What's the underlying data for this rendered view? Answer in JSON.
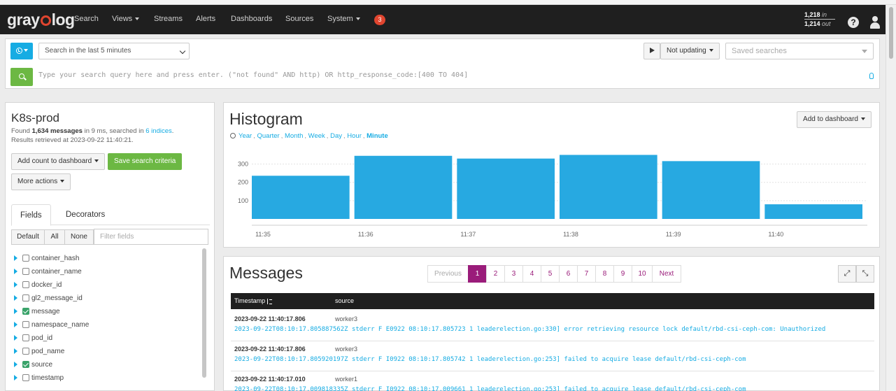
{
  "navbar": {
    "logo": "graylog",
    "items": [
      {
        "label": "Search",
        "dropdown": false
      },
      {
        "label": "Views",
        "dropdown": true
      },
      {
        "label": "Streams",
        "dropdown": false
      },
      {
        "label": "Alerts",
        "dropdown": false
      },
      {
        "label": "Dashboards",
        "dropdown": false
      },
      {
        "label": "Sources",
        "dropdown": false
      },
      {
        "label": "System",
        "dropdown": true
      }
    ],
    "notification_count": "3",
    "throughput": {
      "in_value": "1,218",
      "in_label": "in",
      "out_value": "1,214",
      "out_label": "out"
    },
    "help_icon": "question-circle-icon",
    "user_icon": "user-icon"
  },
  "search": {
    "range_button_icon": "clock-icon",
    "range_selected": "Search in the last 5 minutes",
    "updating_label": "Not updating",
    "saved_searches_placeholder": "Saved searches",
    "query_placeholder": "Type your search query here and press enter. (\"not found\" AND http) OR http_response_code:[400 TO 404]"
  },
  "sidebar": {
    "title": "K8s-prod",
    "found_prefix": "Found",
    "found_count": "1,634 messages",
    "found_middle": "in 9 ms, searched in",
    "indices_link": "6 indices",
    "found_suffix": ".",
    "retrieved": "Results retrieved at 2023-09-22 11:40:21.",
    "add_count_label": "Add count to dashboard",
    "save_criteria_label": "Save search criteria",
    "more_actions_label": "More actions",
    "tabs": [
      "Fields",
      "Decorators"
    ],
    "field_filters": [
      "Default",
      "All",
      "None"
    ],
    "filter_placeholder": "Filter fields",
    "fields": [
      {
        "name": "container_hash",
        "checked": false
      },
      {
        "name": "container_name",
        "checked": false
      },
      {
        "name": "docker_id",
        "checked": false
      },
      {
        "name": "gl2_message_id",
        "checked": false
      },
      {
        "name": "message",
        "checked": true
      },
      {
        "name": "namespace_name",
        "checked": false
      },
      {
        "name": "pod_id",
        "checked": false
      },
      {
        "name": "pod_name",
        "checked": false
      },
      {
        "name": "source",
        "checked": true
      },
      {
        "name": "timestamp",
        "checked": false
      }
    ]
  },
  "histogram": {
    "title": "Histogram",
    "add_to_dashboard": "Add to dashboard",
    "resolutions": [
      "Year",
      "Quarter",
      "Month",
      "Week",
      "Day",
      "Hour",
      "Minute"
    ],
    "active_resolution": "Minute"
  },
  "chart_data": {
    "type": "bar",
    "categories": [
      "11:35",
      "11:36",
      "11:37",
      "11:38",
      "11:39",
      "11:40"
    ],
    "values": [
      236,
      345,
      330,
      350,
      316,
      80
    ],
    "yticks": [
      100,
      200,
      300
    ],
    "ylim": [
      0,
      390
    ],
    "bar_color": "#27a9e1",
    "grid": true
  },
  "messages": {
    "title": "Messages",
    "pagination": [
      "Previous",
      "1",
      "2",
      "3",
      "4",
      "5",
      "6",
      "7",
      "8",
      "9",
      "10",
      "Next"
    ],
    "active_page": "1",
    "columns": [
      "Timestamp",
      "source"
    ],
    "rows": [
      {
        "timestamp": "2023-09-22 11:40:17.806",
        "source": "worker3",
        "message": "2023-09-22T08:10:17.805887562Z stderr F E0922 08:10:17.805723 1 leaderelection.go:330] error retrieving resource lock default/rbd-csi-ceph-com: Unauthorized"
      },
      {
        "timestamp": "2023-09-22 11:40:17.806",
        "source": "worker3",
        "message": "2023-09-22T08:10:17.805920197Z stderr F I0922 08:10:17.805742 1 leaderelection.go:253] failed to acquire lease default/rbd-csi-ceph-com"
      },
      {
        "timestamp": "2023-09-22 11:40:17.010",
        "source": "worker1",
        "message": "2023-09-22T08:10:17.009818335Z stderr F I0922 08:10:17.009661 1 leaderelection.go:253] failed to acquire lease default/rbd-csi-ceph-com"
      }
    ]
  },
  "colors": {
    "accent": "#16ace3",
    "success": "#6cb843",
    "pager_active": "#9a1c7a",
    "navbar_bg": "#1f1f1f",
    "badge": "#e0452f"
  }
}
